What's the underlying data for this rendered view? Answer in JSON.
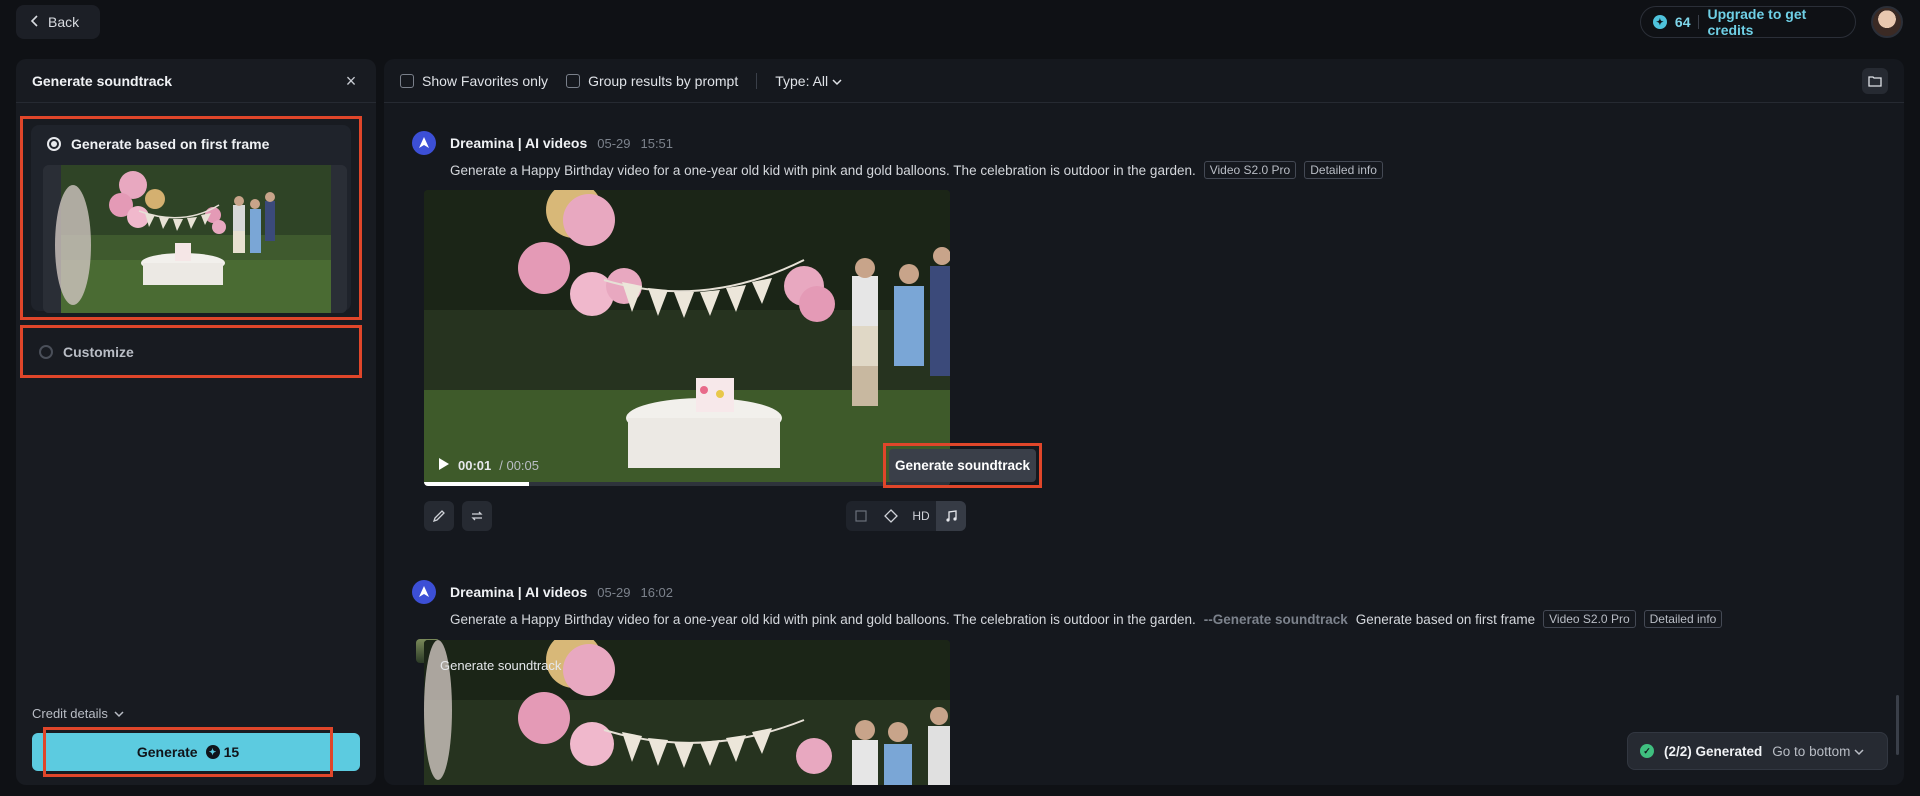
{
  "topbar": {
    "back_label": "Back",
    "credits_count": "64",
    "upgrade_label": "Upgrade to get credits"
  },
  "left_panel": {
    "title": "Generate soundtrack",
    "option_first_frame": "Generate based on first frame",
    "option_customize": "Customize",
    "credit_details": "Credit details",
    "generate_label": "Generate",
    "generate_cost": "15"
  },
  "filters": {
    "favorites": "Show Favorites only",
    "group": "Group results by prompt",
    "type": "Type: All"
  },
  "entries": [
    {
      "author": "Dreamina | AI videos",
      "date": "05-29",
      "time": "15:51",
      "prompt": "Generate a Happy Birthday video for a one-year old kid with pink and gold balloons. The celebration is outdoor in the garden.",
      "model_tag": "Video S2.0 Pro",
      "info_tag": "Detailed info",
      "current_time": "00:01",
      "duration": "/ 00:05"
    },
    {
      "author": "Dreamina | AI videos",
      "date": "05-29",
      "time": "16:02",
      "prompt": "Generate a Happy Birthday video for a one-year old kid with pink and gold balloons. The celebration is outdoor in the garden.",
      "extra_mode": "--Generate soundtrack",
      "extra_detail": "Generate based on first frame",
      "model_tag": "Video S2.0 Pro",
      "info_tag": "Detailed info",
      "overlay_label": "Generate soundtrack"
    }
  ],
  "toolbar": {
    "hd_label": "HD",
    "tooltip": "Generate soundtrack"
  },
  "status": {
    "generated": "(2/2) Generated",
    "goto_bottom": "Go to bottom"
  }
}
